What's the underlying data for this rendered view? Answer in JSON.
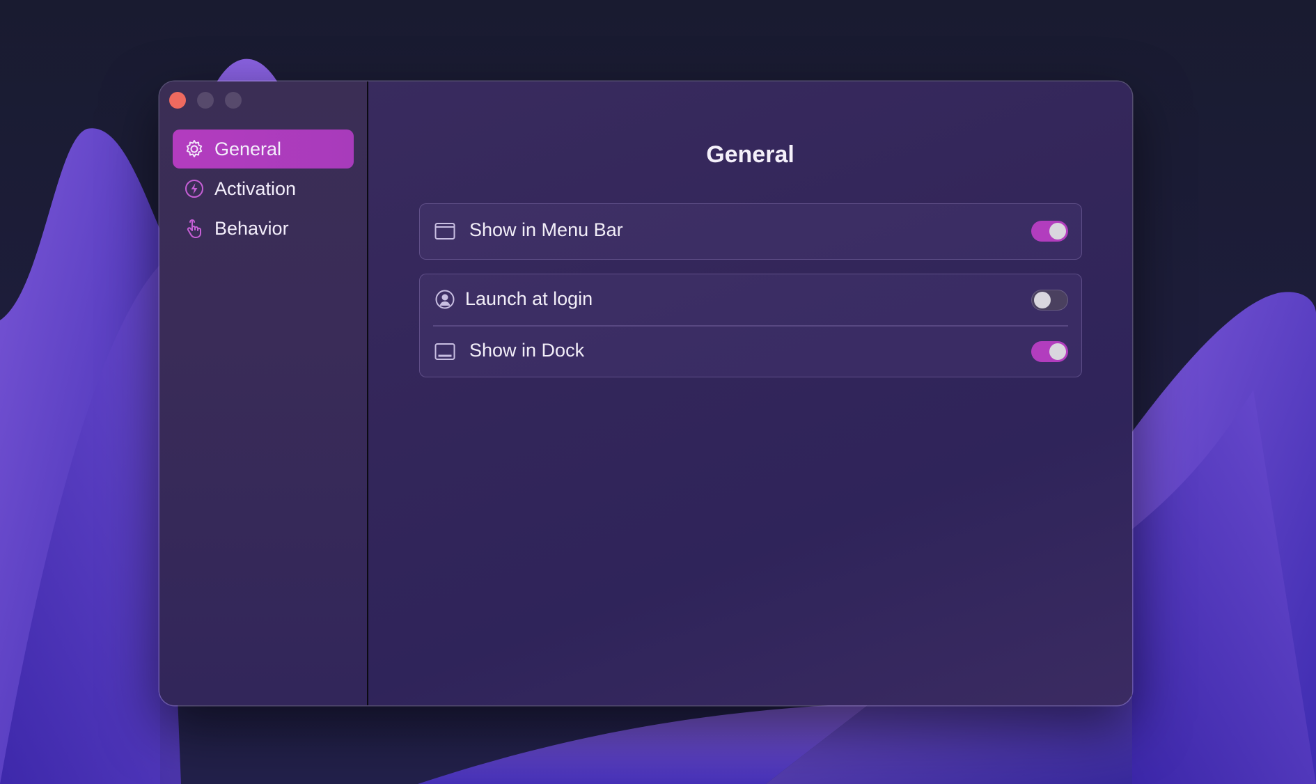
{
  "window": {
    "title": "General"
  },
  "sidebar": {
    "items": [
      {
        "label": "General",
        "icon": "gear-icon",
        "selected": true
      },
      {
        "label": "Activation",
        "icon": "bolt-icon",
        "selected": false
      },
      {
        "label": "Behavior",
        "icon": "hand-pointer-icon",
        "selected": false
      }
    ]
  },
  "settings": {
    "show_in_menu_bar": {
      "label": "Show in Menu Bar",
      "icon": "menubar-window-icon",
      "enabled": true
    },
    "launch_at_login": {
      "label": "Launch at login",
      "icon": "person-circle-icon",
      "enabled": false
    },
    "show_in_dock": {
      "label": "Show in Dock",
      "icon": "dock-icon",
      "enabled": true
    }
  },
  "colors": {
    "accent": "#b23dbe",
    "close_button": "#ee6a5f"
  }
}
